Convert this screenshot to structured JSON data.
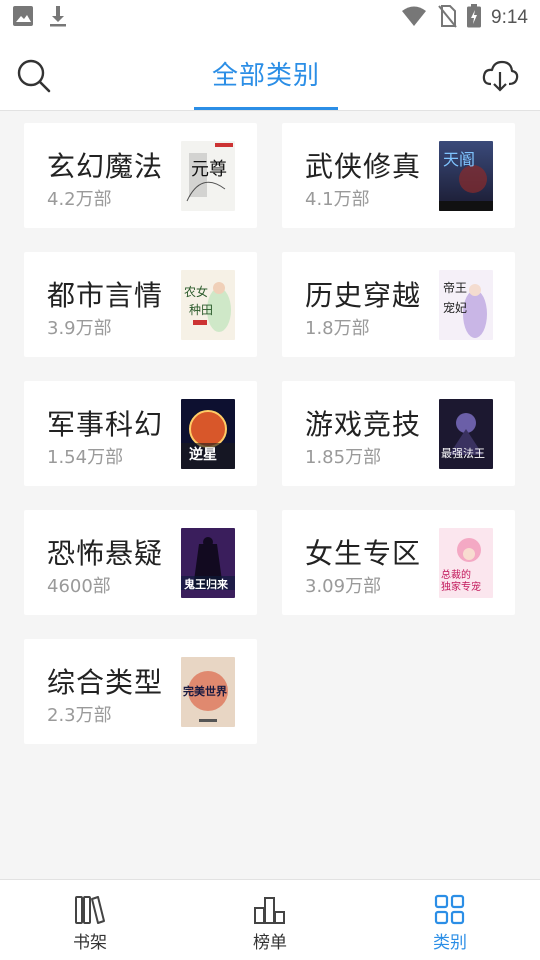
{
  "status_bar": {
    "time": "9:14",
    "left_icons": [
      "image-icon",
      "download-icon"
    ],
    "right_icons": [
      "wifi-icon",
      "no-sim-icon",
      "battery-charging-icon"
    ]
  },
  "header": {
    "title": "全部类别",
    "left_icon": "search-icon",
    "right_icon": "cloud-download-icon",
    "accent_color": "#2b8ee6"
  },
  "categories": [
    {
      "name": "玄幻魔法",
      "count": "4.2万部",
      "cover_text": "元尊"
    },
    {
      "name": "武侠修真",
      "count": "4.1万部",
      "cover_text": "天阍"
    },
    {
      "name": "都市言情",
      "count": "3.9万部",
      "cover_text": "农女种田"
    },
    {
      "name": "历史穿越",
      "count": "1.8万部",
      "cover_text": "帝王宠妃"
    },
    {
      "name": "军事科幻",
      "count": "1.54万部",
      "cover_text": "逆星"
    },
    {
      "name": "游戏竞技",
      "count": "1.85万部",
      "cover_text": "最强法王"
    },
    {
      "name": "恐怖悬疑",
      "count": "4600部",
      "cover_text": "鬼王归来"
    },
    {
      "name": "女生专区",
      "count": "3.09万部",
      "cover_text": "总裁的独家专宠"
    },
    {
      "name": "综合类型",
      "count": "2.3万部",
      "cover_text": "完美世界"
    }
  ],
  "bottom_nav": {
    "items": [
      {
        "label": "书架",
        "icon": "bookshelf-icon",
        "active": false
      },
      {
        "label": "榜单",
        "icon": "ranking-icon",
        "active": false
      },
      {
        "label": "类别",
        "icon": "category-grid-icon",
        "active": true
      }
    ]
  }
}
